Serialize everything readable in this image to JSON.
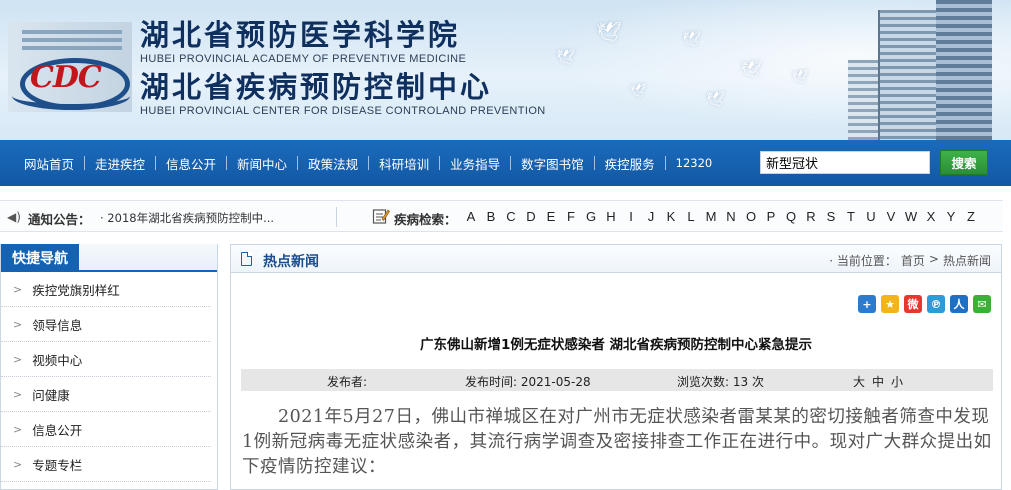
{
  "header": {
    "title_cn_1": "湖北省预防医学科学院",
    "title_en_1": "HUBEI PROVINCIAL ACADEMY OF PREVENTIVE MEDICINE",
    "title_cn_2": "湖北省疾病预防控制中心",
    "title_en_2": "HUBEI PROVINCIAL CENTER FOR DISEASE CONTROLAND PREVENTION",
    "logo_text": "CDC"
  },
  "nav": {
    "items": [
      {
        "label": "网站首页"
      },
      {
        "label": "走进疾控"
      },
      {
        "label": "信息公开"
      },
      {
        "label": "新闻中心"
      },
      {
        "label": "政策法规"
      },
      {
        "label": "科研培训"
      },
      {
        "label": "业务指导"
      },
      {
        "label": "数字图书馆"
      },
      {
        "label": "疾控服务"
      },
      {
        "label": "12320"
      }
    ],
    "search_value": "新型冠状",
    "search_button": "搜索"
  },
  "notice": {
    "label": "通知公告：",
    "text": "· 2018年湖北省疾病预防控制中...",
    "index_label": "疾病检索：",
    "letters": [
      "A",
      "B",
      "C",
      "D",
      "E",
      "F",
      "G",
      "H",
      "I",
      "J",
      "K",
      "L",
      "M",
      "N",
      "O",
      "P",
      "Q",
      "R",
      "S",
      "T",
      "U",
      "V",
      "W",
      "X",
      "Y",
      "Z"
    ]
  },
  "sidebar": {
    "title": "快捷导航",
    "items": [
      {
        "label": "疾控党旗别样红"
      },
      {
        "label": "领导信息"
      },
      {
        "label": "视频中心"
      },
      {
        "label": "问健康"
      },
      {
        "label": "信息公开"
      },
      {
        "label": "专题专栏"
      }
    ]
  },
  "content": {
    "section_title": "热点新闻",
    "breadcrumb": {
      "prefix": "· 当前位置：",
      "home": "首页",
      "sep": ">",
      "current": "热点新闻"
    },
    "share_icons": [
      "share-plus-icon",
      "qzone-icon",
      "weibo-icon",
      "tencent-weibo-icon",
      "renren-icon",
      "wechat-icon"
    ],
    "article": {
      "title": "广东佛山新增1例无症状感染者 湖北省疾病预防控制中心紧急提示",
      "publisher_label": "发布者:",
      "publish_time": "发布时间: 2021-05-28",
      "views": "浏览次数: 13 次",
      "font_sizes": [
        "大",
        "中",
        "小"
      ],
      "body": "2021年5月27日，佛山市禅城区在对广州市无症状感染者雷某某的密切接触者筛查中发现1例新冠病毒无症状感染者，其流行病学调查及密接排查工作正在进行中。现对广大群众提出如下疫情防控建议："
    }
  },
  "colors": {
    "nav_bg": "#1562b3",
    "search_button": "#2f9c38",
    "title_blue": "#0f2f5e",
    "logo_red": "#c3161c"
  }
}
